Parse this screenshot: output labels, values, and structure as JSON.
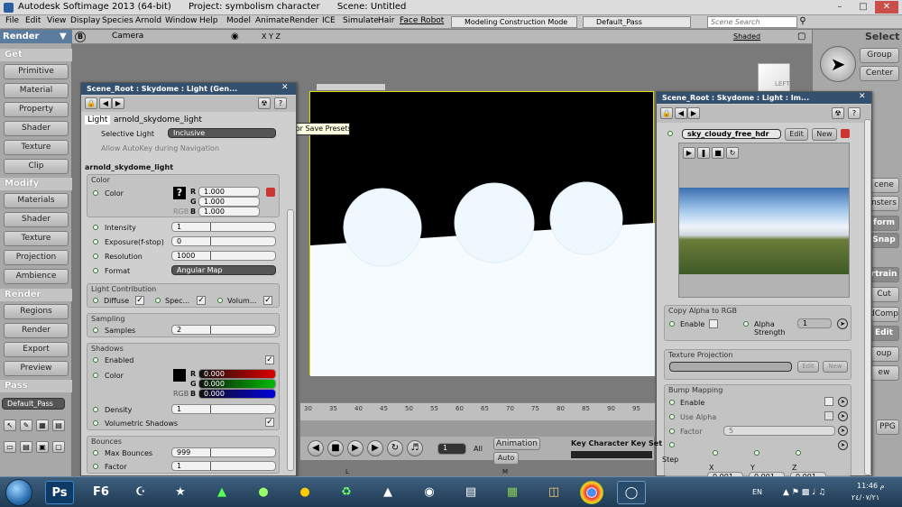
{
  "titlebar": {
    "app": "Autodesk Softimage 2013 (64-bit)",
    "project": "Project: symbolism character",
    "scene": "Scene: Untitled"
  },
  "menubar": {
    "items": [
      "File",
      "Edit",
      "View",
      "Display",
      "Species",
      "Arnold",
      "Window",
      "Help",
      "Model",
      "Animate",
      "Render",
      "ICE",
      "Simulate",
      "Hair",
      "Face Robot"
    ],
    "construction_mode": "Modeling Construction Mode",
    "pass": "Default_Pass",
    "search_placeholder": "Scene Search"
  },
  "camerabar": {
    "view": "Camera",
    "axes": "X Y Z",
    "shading": "Shaded",
    "view_b": "B",
    "cube_label": "LEFT"
  },
  "left_panel": {
    "header": "Render",
    "sections": {
      "get": "Get",
      "modify": "Modify",
      "render": "Render",
      "pass": "Pass"
    },
    "get_items": [
      "Primitive",
      "Material",
      "Property",
      "Shader",
      "Texture",
      "Clip"
    ],
    "modify_items": [
      "Materials",
      "Shader",
      "Texture",
      "Projection",
      "Ambience"
    ],
    "render_items": [
      "Regions",
      "Render",
      "Export",
      "Preview"
    ],
    "pass_value": "Default_Pass"
  },
  "right_panel": {
    "header": "Select",
    "group": "Group",
    "center": "Center",
    "partial": [
      "cene",
      "nsters",
      "form",
      "Snap",
      "rtrain",
      "Cut",
      "dComp",
      "Edit",
      "oup",
      "ew",
      "PPG"
    ]
  },
  "light_ppg": {
    "title": "Scene_Root : Skydome : Light (Gen...",
    "tabs": [
      "Light",
      "arnold_skydome_light"
    ],
    "selective_light_label": "Selective Light",
    "selective_light_value": "Inclusive",
    "allow_autokey": "Allow AutoKey during Navigation",
    "section_title": "arnold_skydome_light",
    "color_group": "Color",
    "color_label": "Color",
    "color_r": "1.000",
    "color_g": "1.000",
    "color_b": "1.000",
    "rgb_label": "RGB",
    "r": "R",
    "g": "G",
    "b": "B",
    "intensity_label": "Intensity",
    "intensity": "1",
    "exposure_label": "Exposure(f-stop)",
    "exposure": "0",
    "resolution_label": "Resolution",
    "resolution": "1000",
    "format_label": "Format",
    "format": "Angular Map",
    "light_contrib_group": "Light Contribution",
    "diffuse": "Diffuse",
    "specular": "Spec...",
    "volume": "Volum...",
    "sampling_group": "Sampling",
    "samples_label": "Samples",
    "samples": "2",
    "shadows_group": "Shadows",
    "enabled": "Enabled",
    "shadow_color_label": "Color",
    "shadow_r": "0.000",
    "shadow_g": "0.000",
    "shadow_b": "0.000",
    "density_label": "Density",
    "density": "1",
    "volumetric_shadows": "Volumetric Shadows",
    "bounces_group": "Bounces",
    "max_bounces_label": "Max Bounces",
    "max_bounces": "999",
    "factor_label": "Factor",
    "factor": "1"
  },
  "tooltip": "Load or Save Presets",
  "image_ppg": {
    "title": "Scene_Root : Skydome : Light : Im...",
    "clip_name": "sky_cloudy_free_hdr",
    "edit": "Edit",
    "new": "New",
    "copy_alpha_group": "Copy Alpha to RGB",
    "enable": "Enable",
    "alpha_strength": "Alpha Strength",
    "alpha_value": "1",
    "texture_projection_group": "Texture Projection",
    "tp_edit": "Edit",
    "tp_new": "New",
    "bump_mapping_group": "Bump Mapping",
    "bump_enable": "Enable",
    "use_alpha": "Use Alpha",
    "factor_label": "Factor",
    "factor": "5",
    "step_label": "Step",
    "x_label": "X",
    "y_label": "Y",
    "z_label": "Z",
    "x": "0.001",
    "y": "0.001",
    "z": "0.001"
  },
  "timeline": {
    "ticks": [
      "30",
      "35",
      "40",
      "45",
      "50",
      "55",
      "60",
      "65",
      "70",
      "75",
      "80",
      "85",
      "90",
      "95"
    ]
  },
  "playback": {
    "frame": "1",
    "all": "All",
    "animation": "Animation",
    "auto": "Auto",
    "key_set": "Key Character Key Set",
    "l": "L",
    "m": "M"
  },
  "taskbar": {
    "apps": [
      "Ps",
      "F6"
    ],
    "lang": "EN",
    "time": "11:46 م",
    "date": "٢٤/٠٧/٢١"
  },
  "colors": {
    "ppg_title": "#34506f",
    "panel_bg": "#cfcfcf",
    "viewport_border": "#e0e000"
  }
}
